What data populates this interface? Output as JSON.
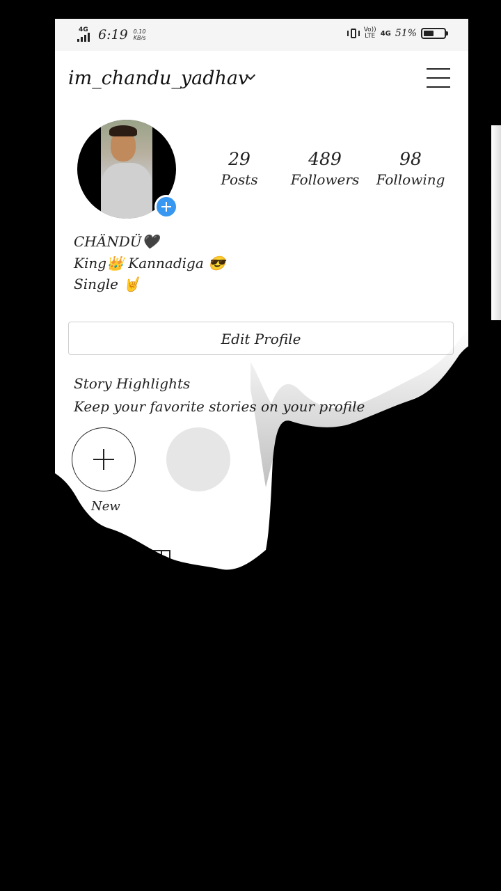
{
  "status_bar": {
    "signal_label": "4G",
    "time": "6:19",
    "net_speed_value": "0.10",
    "net_speed_unit": "KB/s",
    "volte_top": "Vo))",
    "volte_bottom": "LTE",
    "network": "4G",
    "battery_percent": "51%",
    "battery_level": 0.51
  },
  "header": {
    "username": "im_chandu_yadhav"
  },
  "profile": {
    "stats": [
      {
        "value": "29",
        "label": "Posts"
      },
      {
        "value": "489",
        "label": "Followers"
      },
      {
        "value": "98",
        "label": "Following"
      }
    ],
    "bio": [
      "CHÄNDÜ🖤",
      "King👑 Kannadiga 😎",
      "Single 🤘"
    ],
    "edit_profile_label": "Edit Profile"
  },
  "highlights": {
    "title": "Story Highlights",
    "subtitle": "Keep your favorite stories on your profile",
    "new_label": "New"
  },
  "icons": {
    "menu": "hamburger-menu-icon",
    "add_story": "plus-circle-icon",
    "grid": "grid-icon"
  },
  "colors": {
    "accent": "#3897f0",
    "background_effect": "#000000"
  }
}
